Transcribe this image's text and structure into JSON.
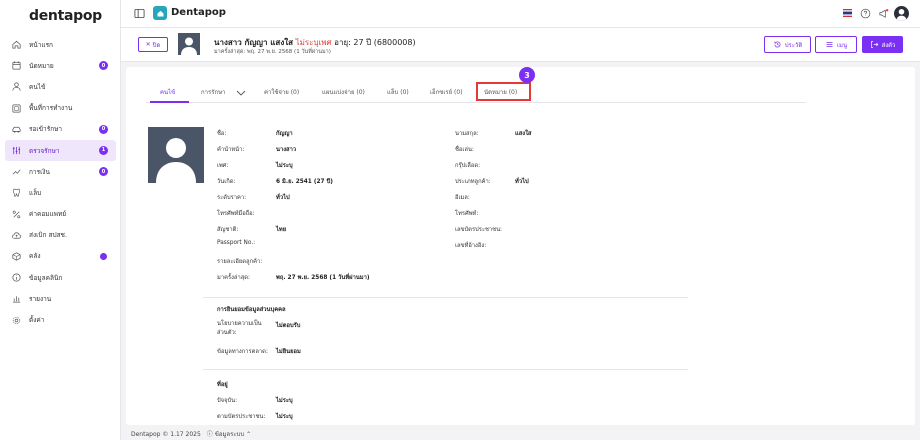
{
  "brand": {
    "logo": "dentapop",
    "accent": "#7b2ff2"
  },
  "sidebar": {
    "items": [
      {
        "label": "หน้าแรก",
        "icon": "home-icon",
        "badge": ""
      },
      {
        "label": "นัดหมาย",
        "icon": "calendar-icon",
        "badge": "0"
      },
      {
        "label": "คนไข้",
        "icon": "user-icon",
        "badge": ""
      },
      {
        "label": "พื้นที่การทำงาน",
        "icon": "workspace-icon",
        "badge": ""
      },
      {
        "label": "รอเข้ารักษา",
        "icon": "car-icon",
        "badge": "0"
      },
      {
        "label": "ตรวจรักษา",
        "icon": "treatment-icon",
        "badge": "1",
        "active": true
      },
      {
        "label": "การเงิน",
        "icon": "finance-icon",
        "badge": "0"
      },
      {
        "label": "แล็บ",
        "icon": "tooth-icon",
        "badge": ""
      },
      {
        "label": "ค่าคอมแพทย์",
        "icon": "percent-icon",
        "badge": ""
      },
      {
        "label": "ส่งเบิก สปสช.",
        "icon": "cloud-upload-icon",
        "badge": ""
      },
      {
        "label": "คลัง",
        "icon": "inventory-icon",
        "badge": "dot"
      },
      {
        "label": "ข้อมูลคลินิก",
        "icon": "info-icon",
        "badge": ""
      },
      {
        "label": "รายงาน",
        "icon": "report-icon",
        "badge": ""
      },
      {
        "label": "ตั้งค่า",
        "icon": "gear-icon",
        "badge": ""
      }
    ]
  },
  "topbar": {
    "app_title": "Dentapop"
  },
  "patient": {
    "name": "นางสาว กัญญา แสงใส",
    "status": "ไม่ระบุเพศ",
    "age_text": "อายุ: 27 ปี (6800008)",
    "last_visit": "มาครั้งล่าสุด: พฤ. 27 พ.ย. 2568 (1 วันที่ผ่านมา)",
    "close_label": "ปิด",
    "history_label": "ประวัติ",
    "menu_label": "เมนู",
    "send_label": "ส่งตัว"
  },
  "tabs": [
    {
      "label": "คนไข้",
      "active": true
    },
    {
      "label": "การรักษา"
    },
    {
      "label": "ค่าใช้จ่าย (0)"
    },
    {
      "label": "แผนแบ่งจ่าย (0)"
    },
    {
      "label": "แล็บ (0)"
    },
    {
      "label": "เอ็กซเรย์ (0)"
    },
    {
      "label": "นัดหมาย (0)"
    }
  ],
  "step_number": "3",
  "info_left": [
    {
      "label": "ชื่อ:",
      "value": "กัญญา"
    },
    {
      "label": "คำนำหน้า:",
      "value": "นางสาว"
    },
    {
      "label": "เพศ:",
      "value": "ไม่ระบุ"
    },
    {
      "label": "วันเกิด:",
      "value": "6 มิ.ย. 2541 (27 ปี)"
    },
    {
      "label": "ระดับราคา:",
      "value": "ทั่วไป"
    },
    {
      "label": "โทรศัพท์มือถือ:",
      "value": ""
    },
    {
      "label": "สัญชาติ:",
      "value": "ไทย"
    },
    {
      "label": "Passport No.:",
      "value": ""
    },
    {
      "label": "รายละเอียดลูกค้า:",
      "value": ""
    },
    {
      "label": "มาครั้งล่าสุด:",
      "value": "พฤ. 27 พ.ย. 2568 (1 วันที่ผ่านมา)"
    }
  ],
  "info_right": [
    {
      "label": "นามสกุล:",
      "value": "แสงใส"
    },
    {
      "label": "ชื่อเล่น:",
      "value": ""
    },
    {
      "label": "กรุ๊ปเลือด:",
      "value": ""
    },
    {
      "label": "ประเภทลูกค้า:",
      "value": "ทั่วไป"
    },
    {
      "label": "อีเมล:",
      "value": ""
    },
    {
      "label": "โทรศัพท์:",
      "value": ""
    },
    {
      "label": "เลขบัตรประชาชน:",
      "value": ""
    },
    {
      "label": "เลขที่อ้างอิง:",
      "value": ""
    }
  ],
  "consent": {
    "title": "การยินยอมข้อมูลส่วนบุคคล",
    "rows": [
      {
        "label": "นโยบายความเป็นส่วนตัว:",
        "value": "ไม่ตอบรับ"
      },
      {
        "label": "ข้อมูลทางการตลาด:",
        "value": "ไม่ยินยอม"
      }
    ]
  },
  "address": {
    "title": "ที่อยู่",
    "rows": [
      {
        "label": "ปัจจุบัน:",
        "value": "ไม่ระบุ"
      },
      {
        "label": "ตามบัตรประชาชน:",
        "value": "ไม่ระบุ"
      }
    ]
  },
  "footer": {
    "copyright": "Dentapop © 1.17 2025",
    "system_info": "ข้อมูลระบบ"
  }
}
